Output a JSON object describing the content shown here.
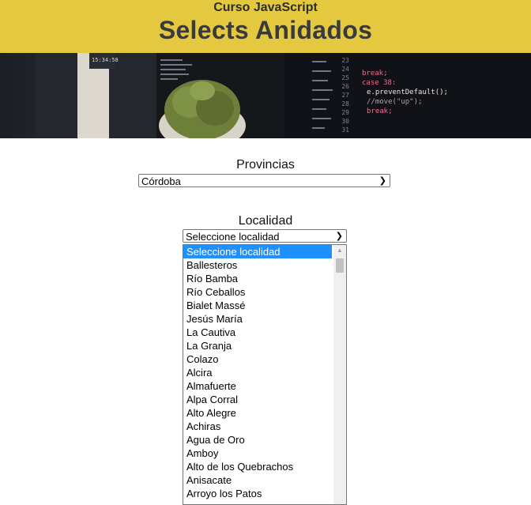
{
  "header": {
    "subtitle": "Curso JavaScript",
    "title": "Selects Anidados"
  },
  "banner": {
    "code_lines": [
      "break;",
      "case 38:",
      "e.preventDefault();",
      "//move(\"up\");",
      "break;"
    ],
    "line_numbers": [
      "23",
      "24",
      "25",
      "26",
      "27",
      "28",
      "29",
      "30",
      "31"
    ]
  },
  "provincias": {
    "label": "Provincias",
    "selected": "Córdoba"
  },
  "localidad": {
    "label": "Localidad",
    "selected": "Seleccione localidad",
    "options": [
      "Seleccione localidad",
      "Ballesteros",
      "Río Bamba",
      "Río Ceballos",
      "Bialet Massé",
      "Jesús María",
      "La Cautiva",
      "La Granja",
      "Colazo",
      "Alcira",
      "Almafuerte",
      "Alpa Corral",
      "Alto Alegre",
      "Achiras",
      "Agua de Oro",
      "Amboy",
      "Alto de los Quebrachos",
      "Anisacate",
      "Arroyo los Patos"
    ]
  },
  "colors": {
    "header_bg": "#e3c840",
    "highlight": "#1e90ff"
  }
}
